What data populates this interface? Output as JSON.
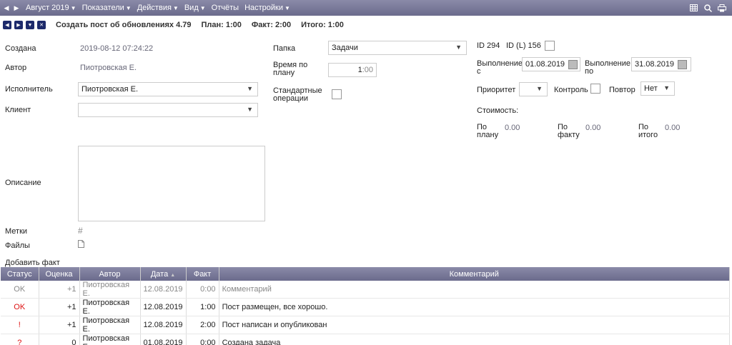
{
  "menu": {
    "period": "Август 2019",
    "items": [
      "Показатели",
      "Действия",
      "Вид",
      "Отчёты",
      "Настройки"
    ]
  },
  "toolbar": {
    "title": "Создать пост об обновлениях 4.79",
    "plan": "План: 1:00",
    "fact": "Факт: 2:00",
    "total": "Итого: 1:00"
  },
  "form": {
    "created_label": "Создана",
    "created_value": "2019-08-12 07:24:22",
    "author_label": "Автор",
    "author_value": "Пиотровская Е.",
    "executor_label": "Исполнитель",
    "executor_value": "Пиотровская Е.",
    "client_label": "Клиент",
    "client_value": "",
    "description_label": "Описание",
    "tags_label": "Метки",
    "files_label": "Файлы",
    "add_fact_label": "Добавить факт",
    "folder_label": "Папка",
    "folder_value": "Задачи",
    "planned_time_label": "Время по плану",
    "planned_time_hours": "1",
    "planned_time_minutes": "00",
    "standard_ops_label": "Стандартные операции",
    "id_label": "ID 294",
    "idl_label": "ID (L) 156",
    "exec_from_label": "Выполнение с",
    "exec_from_value": "01.08.2019",
    "exec_to_label": "Выполнение по",
    "exec_to_value": "31.08.2019",
    "priority_label": "Приоритет",
    "control_label": "Контроль",
    "repeat_label": "Повтор",
    "repeat_value": "Нет",
    "cost_label": "Стоимость:",
    "cost_plan_label": "По плану",
    "cost_plan_value": "0.00",
    "cost_fact_label": "По факту",
    "cost_fact_value": "0.00",
    "cost_total_label": "По итого",
    "cost_total_value": "0.00"
  },
  "table": {
    "headers": [
      "Статус",
      "Оценка",
      "Автор",
      "Дата",
      "Факт",
      "Комментарий"
    ],
    "rows": [
      {
        "status": "OK",
        "score": "+1",
        "author": "Пиотровская Е.",
        "date": "12.08.2019",
        "fact": "0:00",
        "comment": "Комментарий"
      },
      {
        "status": "OK",
        "score": "+1",
        "author": "Пиотровская Е.",
        "date": "12.08.2019",
        "fact": "1:00",
        "comment": "Пост размещен, все хорошо."
      },
      {
        "status": "!",
        "score": "+1",
        "author": "Пиотровская Е.",
        "date": "12.08.2019",
        "fact": "2:00",
        "comment": "Пост написан и опубликован"
      },
      {
        "status": "?",
        "score": "0",
        "author": "Пиотровская Е.",
        "date": "01.08.2019",
        "fact": "0:00",
        "comment": "Создана задача"
      }
    ]
  },
  "colors": {
    "menubar": "#7a7a9a",
    "nav_button": "#1d2a6b",
    "status_red": "#dd1111"
  }
}
